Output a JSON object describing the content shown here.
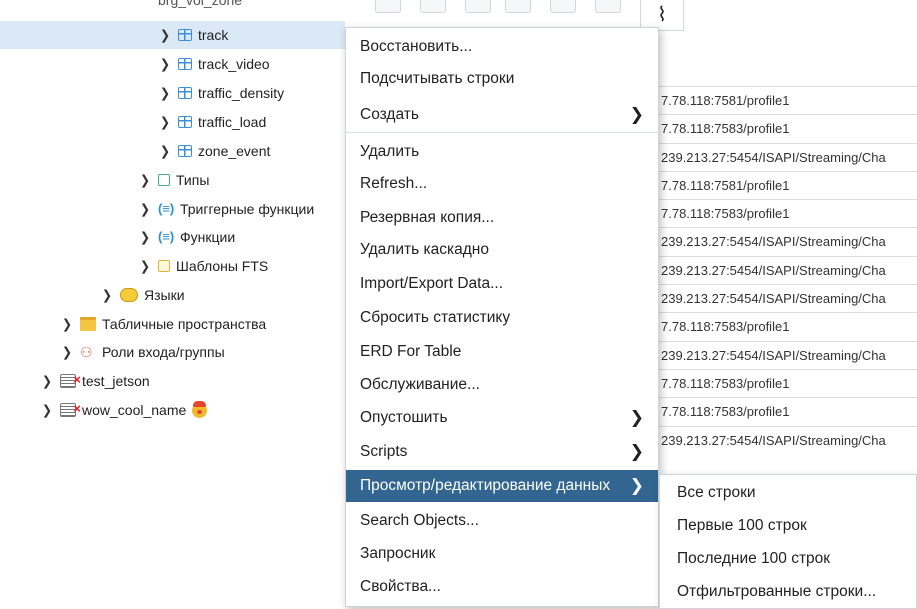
{
  "tree": {
    "clipped_label": "brg_vol_zone",
    "rows": [
      {
        "label": "track",
        "icon": "table-icon"
      },
      {
        "label": "track_video",
        "icon": "table-icon"
      },
      {
        "label": "traffic_density",
        "icon": "table-icon"
      },
      {
        "label": "traffic_load",
        "icon": "table-icon"
      },
      {
        "label": "zone_event",
        "icon": "table-icon"
      },
      {
        "label": "Типы",
        "icon": "types-icon"
      },
      {
        "label": "Триггерные функции",
        "icon": "trigger-function-icon"
      },
      {
        "label": "Функции",
        "icon": "function-icon"
      },
      {
        "label": "Шаблоны FTS",
        "icon": "fts-template-icon"
      },
      {
        "label": "Языки",
        "icon": "language-icon"
      },
      {
        "label": "Табличные пространства",
        "icon": "tablespace-icon"
      },
      {
        "label": "Роли входа/группы",
        "icon": "roles-icon"
      },
      {
        "label": "test_jetson",
        "icon": "server-disconnected-icon"
      },
      {
        "label": "wow_cool_name",
        "icon": "server-disconnected-icon"
      }
    ]
  },
  "data_rows": [
    "7.78.118:7581/profile1",
    "7.78.118:7583/profile1",
    "239.213.27:5454/ISAPI/Streaming/Cha",
    "7.78.118:7581/profile1",
    "7.78.118:7583/profile1",
    "239.213.27:5454/ISAPI/Streaming/Cha",
    "239.213.27:5454/ISAPI/Streaming/Cha",
    "239.213.27:5454/ISAPI/Streaming/Cha",
    "7.78.118:7583/profile1",
    "239.213.27:5454/ISAPI/Streaming/Cha",
    "7.78.118:7583/profile1",
    "7.78.118:7583/profile1",
    "239.213.27:5454/ISAPI/Streaming/Cha"
  ],
  "context_menu": {
    "items": [
      {
        "label": "Восстановить...",
        "submenu": false
      },
      {
        "label": "Подсчитывать строки",
        "submenu": false
      },
      {
        "label": "Создать",
        "submenu": true
      },
      {
        "label": "Удалить",
        "submenu": false
      },
      {
        "label": "Refresh...",
        "submenu": false
      },
      {
        "label": "Резервная копия...",
        "submenu": false
      },
      {
        "label": "Удалить каскадно",
        "submenu": false
      },
      {
        "label": "Import/Export Data...",
        "submenu": false
      },
      {
        "label": "Сбросить статистику",
        "submenu": false
      },
      {
        "label": "ERD For Table",
        "submenu": false
      },
      {
        "label": "Обслуживание...",
        "submenu": false
      },
      {
        "label": "Опустошить",
        "submenu": true
      },
      {
        "label": "Scripts",
        "submenu": true
      },
      {
        "label": "Просмотр/редактирование данных",
        "submenu": true
      },
      {
        "label": "Search Objects...",
        "submenu": false
      },
      {
        "label": "Запросник",
        "submenu": false
      },
      {
        "label": "Свойства...",
        "submenu": false
      }
    ],
    "arrow_glyph": "❯"
  },
  "submenu": {
    "items": [
      "Все строки",
      "Первые 100 строк",
      "Последние 100 строк",
      "Отфильтрованные строки..."
    ]
  },
  "colors": {
    "selected_row": "#dbe9f7",
    "menu_active": "#326690",
    "table_icon": "#3a8fd6"
  }
}
